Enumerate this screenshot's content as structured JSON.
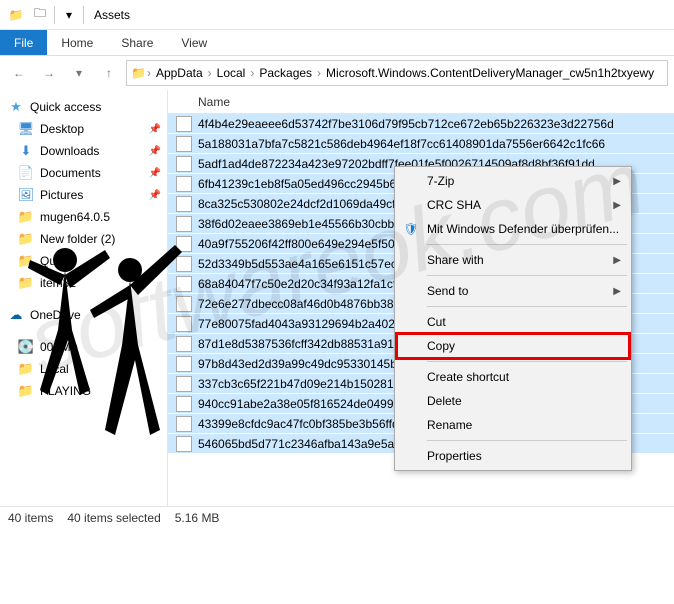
{
  "titlebar": {
    "title": "Assets"
  },
  "ribbon": {
    "file": "File",
    "home": "Home",
    "share": "Share",
    "view": "View"
  },
  "breadcrumb": [
    "AppData",
    "Local",
    "Packages",
    "Microsoft.Windows.ContentDeliveryManager_cw5n1h2txyewy"
  ],
  "nav": {
    "quick_access": "Quick access",
    "desktop": "Desktop",
    "downloads": "Downloads",
    "documents": "Documents",
    "pictures": "Pictures",
    "mugen": "mugen64.0.5",
    "new_folder": "New folder (2)",
    "quir": "Quir",
    "item32": "item32",
    "onedrive": "OneDrive",
    "drive_m": "00 (M:)",
    "local": "Local",
    "playing": "PLAYING"
  },
  "columns": {
    "name": "Name"
  },
  "files": [
    "4f4b4e29eaeee6d53742f7be3106d79f95cb712ce672eb65b226323e3d22756d",
    "5a188031a7bfa7c5821c586deb4964ef18f7cc61408901da7556er6642c1fc66",
    "5adf1ad4de872234a423e97202bdff7fee01fe5f0026714509af8d8bf36f91dd",
    "6fb41239c1eb8f5a05ed496cc2945b6b05e90f22c3f74ec6e0b8b30154d5e199",
    "8ca325c530802e24dcf2d1069da49cf8a0509765bcba7214cce7ad47e2da4",
    "38f6d02eaee3869eb1e45566b30cbb2f6bb55438293b82bb9a0297e2e4",
    "40a9f755206f42ff800e649e294e5f50d4322708cd9abf758b984e3e0cce",
    "52d3349b5d553ae4a165e6151c57ecd7d42eb2dd022c22a65f7963d",
    "68a84047f7c50e2d20c34f93a12fa1cf1d800cb7615b3e1d184b3",
    "72e6e277dbecc08af46d0b4876bb382ba3ae91a120d240caa8a",
    "77e80075fad4043a93129694b2a402787428705cb488bba",
    "87d1e8d5387536fcff342db88531a9139b28ce30786557",
    "97b8d43ed2d39a99c49dc95330145bb312795771bab",
    "337cb3c65f221b47d09e214b1502817d8f759552",
    "940cc91abe2a38e05f816524de0499cf6b6298",
    "43399e8cfdc9ac47fc0bf385be3b56ffd494",
    "546065bd5d771c2346afba143a9e5ad"
  ],
  "context_menu": {
    "sevenzip": "7-Zip",
    "crc": "CRC SHA",
    "defender": "Mit Windows Defender überprüfen...",
    "share_with": "Share with",
    "send_to": "Send to",
    "cut": "Cut",
    "copy": "Copy",
    "create_shortcut": "Create shortcut",
    "delete": "Delete",
    "rename": "Rename",
    "properties": "Properties"
  },
  "status": {
    "items": "40 items",
    "selected": "40 items selected",
    "size": "5.16 MB"
  }
}
